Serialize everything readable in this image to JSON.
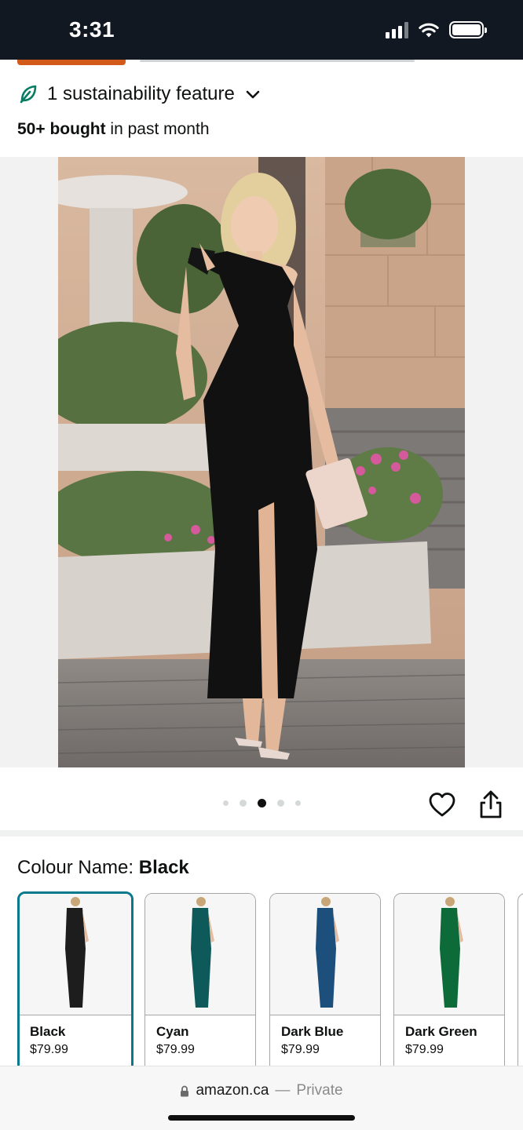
{
  "status_bar": {
    "time": "3:31"
  },
  "sustainability": {
    "label": "1 sustainability feature"
  },
  "bought": {
    "bold": "50+ bought",
    "rest": " in past month"
  },
  "carousel": {
    "dots": 5,
    "active_index": 2
  },
  "colour": {
    "label": "Colour Name: ",
    "selected": "Black"
  },
  "swatches": [
    {
      "name": "Black",
      "price": "$79.99",
      "color": "#1d1d1d"
    },
    {
      "name": "Cyan",
      "price": "$79.99",
      "color": "#0e5a5a"
    },
    {
      "name": "Dark Blue",
      "price": "$79.99",
      "color": "#1d4f7c"
    },
    {
      "name": "Dark Green",
      "price": "$79.99",
      "color": "#0d6b3a"
    }
  ],
  "browser": {
    "domain": "amazon.ca",
    "separator": "—",
    "mode": "Private"
  },
  "colors": {
    "selected_border": "#087a8c",
    "leaf": "#067d62",
    "accent_orange": "#d25a1b"
  }
}
